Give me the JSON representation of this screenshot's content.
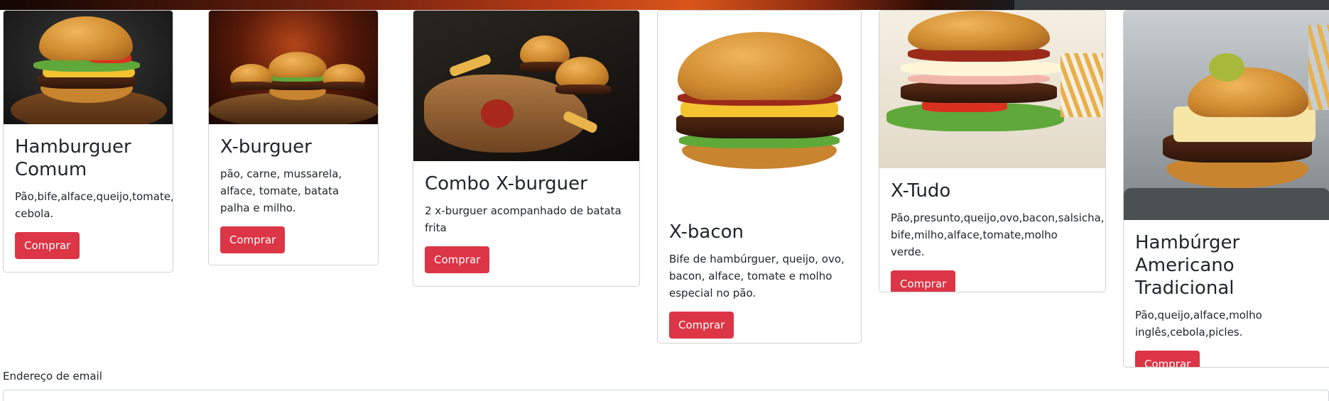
{
  "products": [
    {
      "title": "Hamburguer Comum",
      "description": "Pão,bife,alface,queijo,tomate, cebola.",
      "button": "Comprar"
    },
    {
      "title": "X-burguer",
      "description": "pão, carne, mussarela, alface, tomate, batata palha e milho.",
      "button": "Comprar"
    },
    {
      "title": "Combo X-burguer",
      "description": "2 x-burguer acompanhado de batata frita",
      "button": "Comprar"
    },
    {
      "title": "X-bacon",
      "description": "Bife de hambúrguer, queijo, ovo, bacon, alface, tomate e molho especial no pão.",
      "button": "Comprar"
    },
    {
      "title": "X-Tudo",
      "description": "Pão,presunto,queijo,ovo,bacon,salsicha, bife,milho,alface,tomate,molho verde.",
      "button": "Comprar"
    },
    {
      "title": "Hambúrger Americano Tradicional",
      "description": "Pão,queijo,alface,molho inglês,cebola,picles.",
      "button": "Comprar"
    }
  ],
  "form": {
    "email_label": "Endereço de email",
    "email_value": ""
  },
  "colors": {
    "button": "#dc3545",
    "card_border": "#dcdcdc"
  },
  "icons": [
    "burger-image",
    "fire-burger-image",
    "combo-image",
    "bacon-burger-image",
    "x-tudo-image",
    "american-burger-image"
  ]
}
